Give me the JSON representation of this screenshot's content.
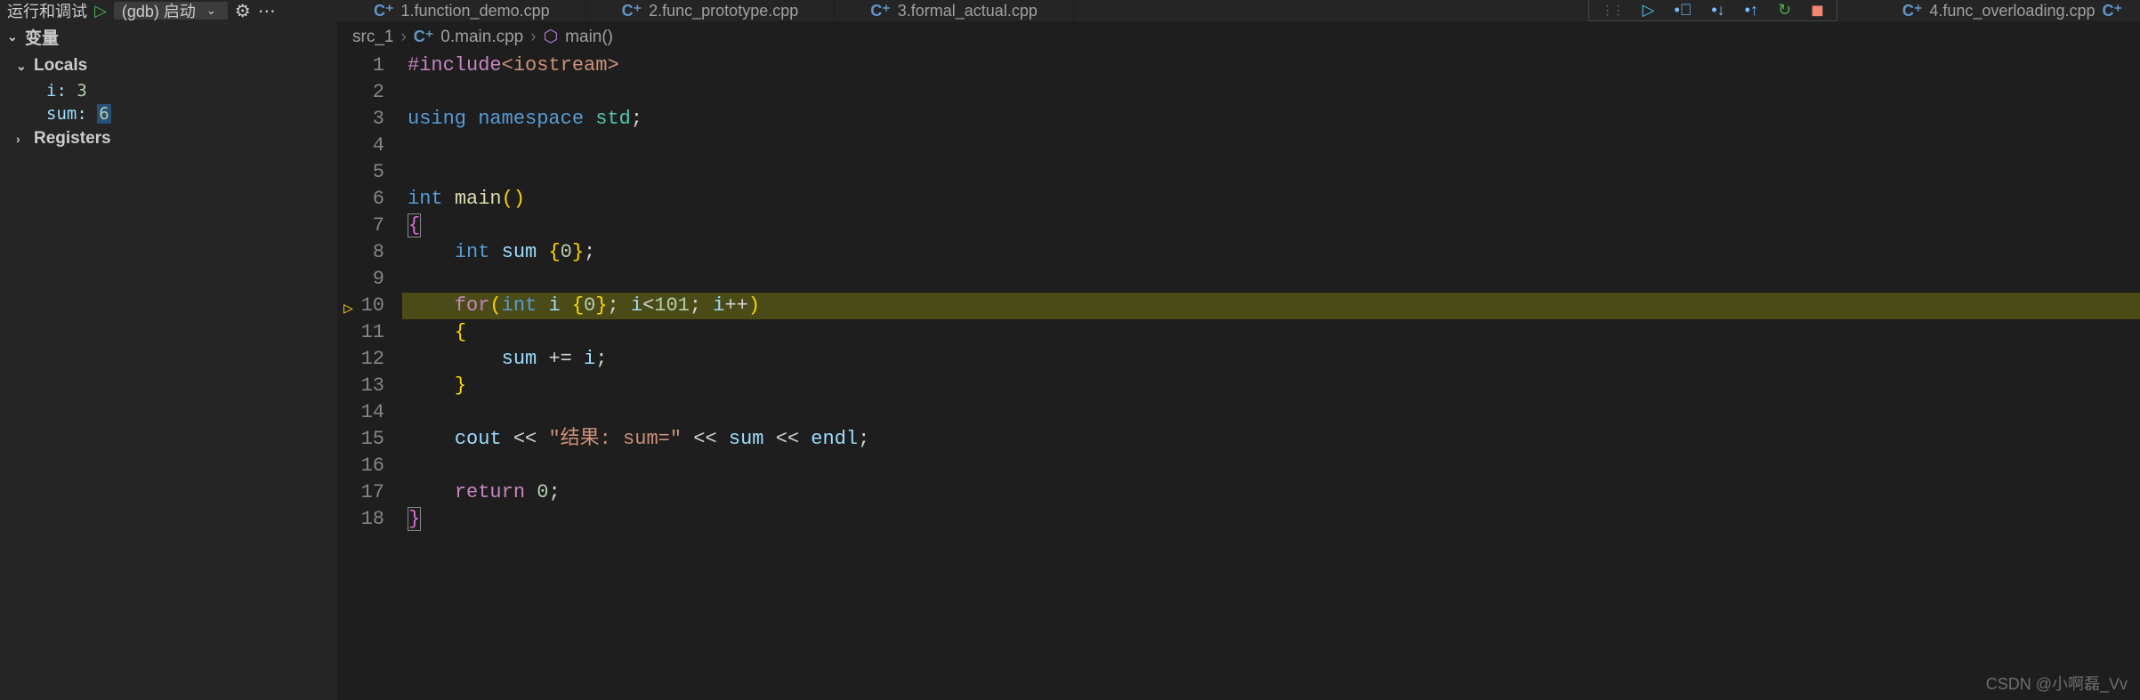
{
  "topbar": {
    "run_debug_label": "运行和调试",
    "launch_config": "(gdb) 启动"
  },
  "tabs": [
    {
      "icon": "C⁺",
      "label": "1.function_demo.cpp"
    },
    {
      "icon": "C⁺",
      "label": "2.func_prototype.cpp"
    },
    {
      "icon": "C⁺",
      "label": "3.formal_actual.cpp"
    }
  ],
  "overflow_tab": {
    "icon": "C⁺",
    "label": "4.func_overloading.cpp"
  },
  "sidebar": {
    "variables_header": "变量",
    "locals_header": "Locals",
    "vars": [
      {
        "name": "i:",
        "value": "3",
        "hl": false
      },
      {
        "name": "sum:",
        "value": "6",
        "hl": true
      }
    ],
    "registers_header": "Registers"
  },
  "breadcrumb": {
    "root": "src_1",
    "file_icon": "C⁺",
    "file": "0.main.cpp",
    "symbol": "main()"
  },
  "code": {
    "lines": [
      {
        "n": 1,
        "html": "<span class='tok-directive'>#include</span><span class='tok-string'>&lt;iostream&gt;</span>"
      },
      {
        "n": 2,
        "html": ""
      },
      {
        "n": 3,
        "html": "<span class='tok-keyword'>using</span> <span class='tok-keyword'>namespace</span> <span class='tok-ns'>std</span><span class='tok-punct'>;</span>"
      },
      {
        "n": 4,
        "html": ""
      },
      {
        "n": 5,
        "html": ""
      },
      {
        "n": 6,
        "html": "<span class='tok-keyword'>int</span> <span class='tok-func'>main</span><span class='tok-brace'>()</span>"
      },
      {
        "n": 7,
        "html": "<span class='tok-brace-match'>{</span>"
      },
      {
        "n": 8,
        "html": "    <span class='tok-keyword'>int</span> <span class='tok-var'>sum</span> <span class='tok-brace'>{</span><span class='tok-num'>0</span><span class='tok-brace'>}</span><span class='tok-punct'>;</span>"
      },
      {
        "n": 9,
        "html": ""
      },
      {
        "n": 10,
        "html": "    <span class='tok-control'>for</span><span class='tok-brace'>(</span><span class='tok-keyword'>int</span> <span class='tok-var'>i</span> <span class='tok-brace'>{</span><span class='tok-num'>0</span><span class='tok-brace'>}</span><span class='tok-punct'>;</span> <span class='tok-var'>i</span><span class='tok-op'>&lt;</span><span class='tok-num'>101</span><span class='tok-punct'>;</span> <span class='tok-var'>i</span><span class='tok-op'>++</span><span class='tok-brace'>)</span>",
        "highlight": true,
        "arrow": true
      },
      {
        "n": 11,
        "html": "    <span class='tok-brace'>{</span>"
      },
      {
        "n": 12,
        "html": "        <span class='tok-var'>sum</span> <span class='tok-op'>+=</span> <span class='tok-var'>i</span><span class='tok-punct'>;</span>"
      },
      {
        "n": 13,
        "html": "    <span class='tok-brace'>}</span>"
      },
      {
        "n": 14,
        "html": ""
      },
      {
        "n": 15,
        "html": "    <span class='tok-var'>cout</span> <span class='tok-op'>&lt;&lt;</span> <span class='tok-string'>\"结果: sum=\"</span> <span class='tok-op'>&lt;&lt;</span> <span class='tok-var'>sum</span> <span class='tok-op'>&lt;&lt;</span> <span class='tok-var'>endl</span><span class='tok-punct'>;</span>"
      },
      {
        "n": 16,
        "html": ""
      },
      {
        "n": 17,
        "html": "    <span class='tok-control'>return</span> <span class='tok-num'>0</span><span class='tok-punct'>;</span>"
      },
      {
        "n": 18,
        "html": "<span class='tok-brace-match'>}</span>"
      }
    ]
  },
  "watermark": "CSDN @小啊磊_Vv"
}
